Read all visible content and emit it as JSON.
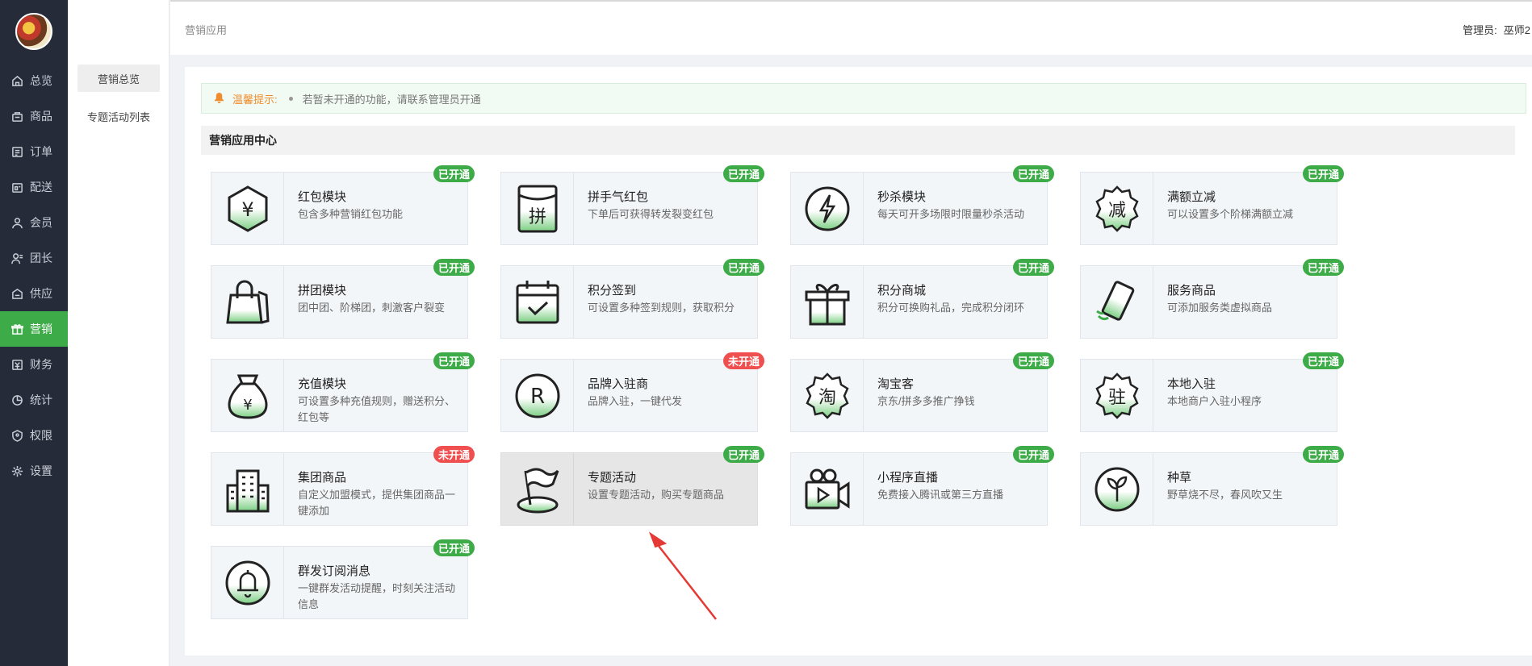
{
  "sidebar": {
    "items": [
      {
        "label": "总览",
        "icon": "home-icon",
        "active": false
      },
      {
        "label": "商品",
        "icon": "goods-icon",
        "active": false
      },
      {
        "label": "订单",
        "icon": "order-icon",
        "active": false
      },
      {
        "label": "配送",
        "icon": "delivery-icon",
        "active": false
      },
      {
        "label": "会员",
        "icon": "member-icon",
        "active": false
      },
      {
        "label": "团长",
        "icon": "leader-icon",
        "active": false
      },
      {
        "label": "供应",
        "icon": "supply-icon",
        "active": false
      },
      {
        "label": "营销",
        "icon": "gift-icon",
        "active": true
      },
      {
        "label": "财务",
        "icon": "finance-icon",
        "active": false
      },
      {
        "label": "统计",
        "icon": "stats-icon",
        "active": false
      },
      {
        "label": "权限",
        "icon": "permission-icon",
        "active": false
      },
      {
        "label": "设置",
        "icon": "gear-icon",
        "active": false
      }
    ]
  },
  "subnav": {
    "items": [
      {
        "label": "营销总览",
        "active": true
      },
      {
        "label": "专题活动列表",
        "active": false
      }
    ]
  },
  "header": {
    "breadcrumb": "营销应用",
    "admin_label": "管理员:",
    "admin_name": "巫师2"
  },
  "notice": {
    "title": "温馨提示:",
    "message": "若暂未开通的功能，请联系管理员开通"
  },
  "section_title": "营销应用中心",
  "colors": {
    "accent": "#3dab47",
    "enabled_badge": "#3dab47",
    "disabled_badge": "#ef4f4f",
    "sidebar_bg": "#262b39"
  },
  "apps": [
    {
      "name": "红包模块",
      "desc": "包含多种营销红包功能",
      "status": "已开通",
      "icon": "red-packet-icon"
    },
    {
      "name": "拼手气红包",
      "desc": "下单后可获得转发裂变红包",
      "status": "已开通",
      "icon": "lucky-packet-icon"
    },
    {
      "name": "秒杀模块",
      "desc": "每天可开多场限时限量秒杀活动",
      "status": "已开通",
      "icon": "flash-sale-icon"
    },
    {
      "name": "满额立减",
      "desc": "可以设置多个阶梯满额立减",
      "status": "已开通",
      "icon": "discount-icon"
    },
    {
      "name": "拼团模块",
      "desc": "团中团、阶梯团，刺激客户裂变",
      "status": "已开通",
      "icon": "shopping-bag-icon"
    },
    {
      "name": "积分签到",
      "desc": "可设置多种签到规则，获取积分",
      "status": "已开通",
      "icon": "calendar-check-icon"
    },
    {
      "name": "积分商城",
      "desc": "积分可换购礼品，完成积分闭环",
      "status": "已开通",
      "icon": "gift-box-icon"
    },
    {
      "name": "服务商品",
      "desc": "可添加服务类虚拟商品",
      "status": "已开通",
      "icon": "service-phone-icon"
    },
    {
      "name": "充值模块",
      "desc": "可设置多种充值规则，赠送积分、红包等",
      "status": "已开通",
      "icon": "money-bag-icon"
    },
    {
      "name": "品牌入驻商",
      "desc": "品牌入驻，一键代发",
      "status": "未开通",
      "icon": "brand-r-icon"
    },
    {
      "name": "淘宝客",
      "desc": "京东/拼多多推广挣钱",
      "status": "已开通",
      "icon": "taobao-icon"
    },
    {
      "name": "本地入驻",
      "desc": "本地商户入驻小程序",
      "status": "已开通",
      "icon": "local-store-icon"
    },
    {
      "name": "集团商品",
      "desc": "自定义加盟模式，提供集团商品一键添加",
      "status": "未开通",
      "icon": "building-icon"
    },
    {
      "name": "专题活动",
      "desc": "设置专题活动，购买专题商品",
      "status": "已开通",
      "icon": "flag-icon"
    },
    {
      "name": "小程序直播",
      "desc": "免费接入腾讯或第三方直播",
      "status": "已开通",
      "icon": "video-camera-icon"
    },
    {
      "name": "种草",
      "desc": "野草烧不尽，春风吹又生",
      "status": "已开通",
      "icon": "sprout-icon"
    },
    {
      "name": "群发订阅消息",
      "desc": "一键群发活动提醒，时刻关注活动信息",
      "status": "已开通",
      "icon": "bell-icon"
    }
  ]
}
